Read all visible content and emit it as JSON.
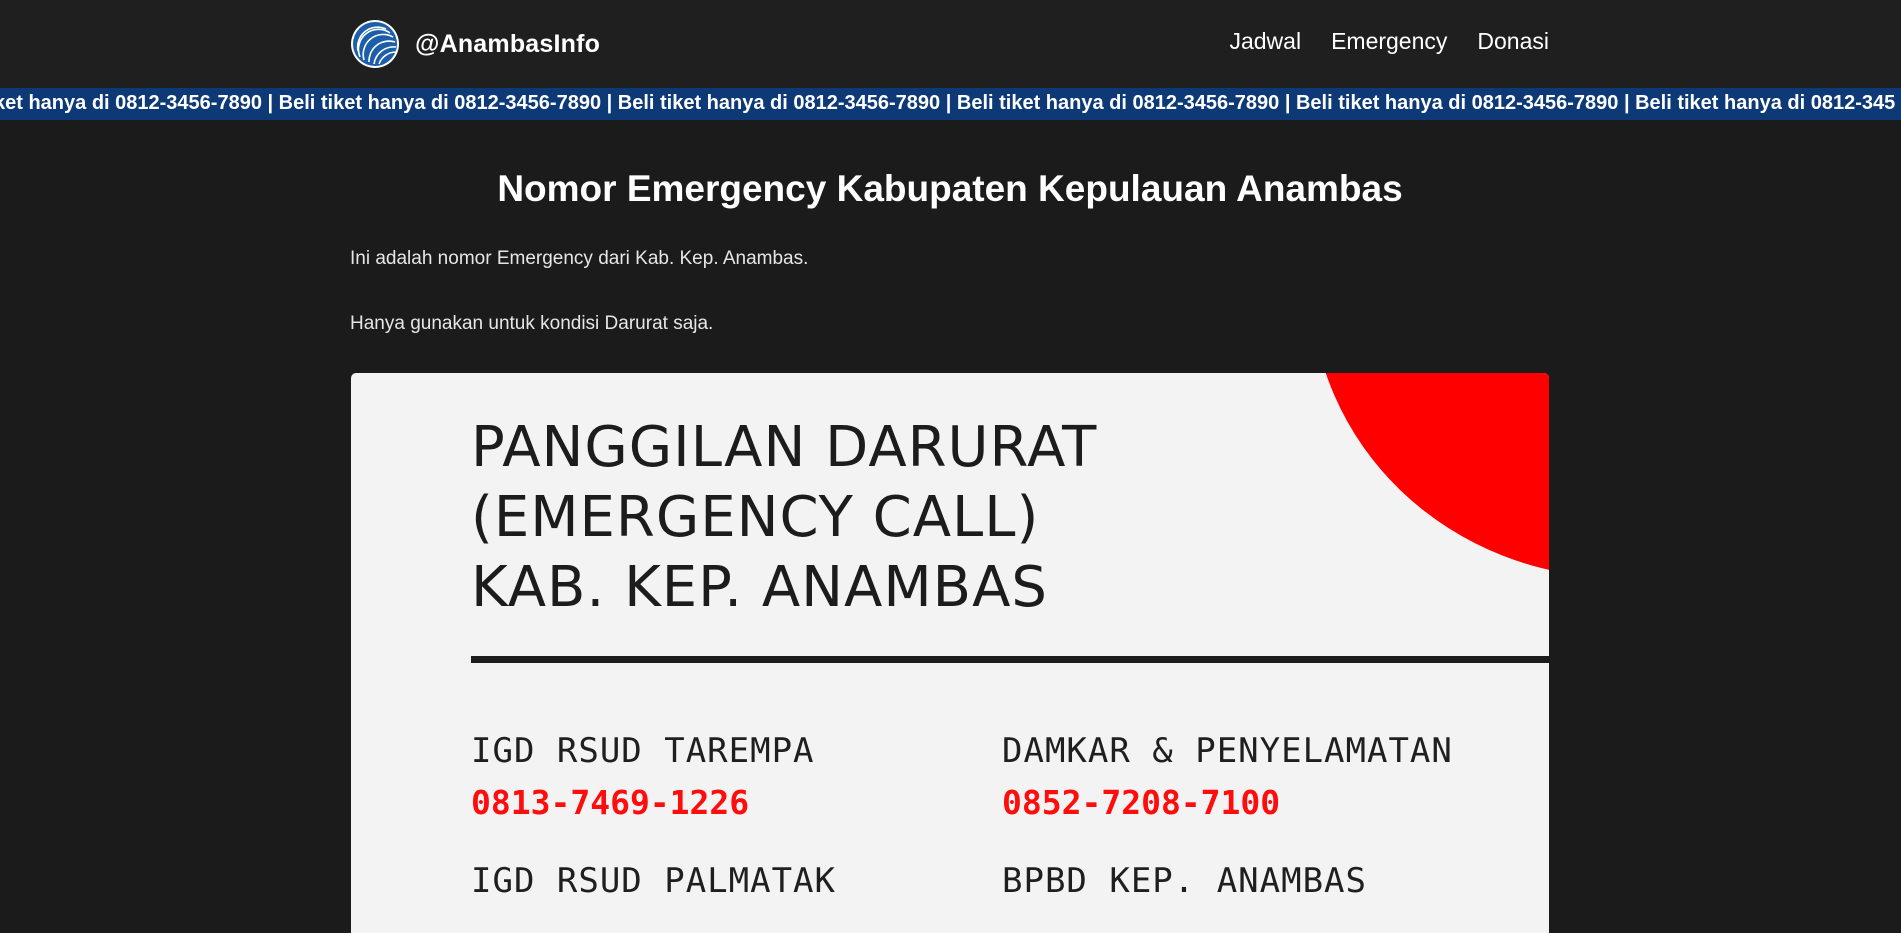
{
  "nav": {
    "brand": "@AnambasInfo",
    "links": [
      "Jadwal",
      "Emergency",
      "Donasi"
    ]
  },
  "ticker": {
    "text": "ket hanya di 0812-3456-7890 | Beli tiket hanya di 0812-3456-7890 | Beli tiket hanya di 0812-3456-7890 | Beli tiket hanya di 0812-3456-7890 | Beli tiket hanya di 0812-3456-7890 | Beli tiket hanya di 0812-345"
  },
  "main": {
    "title": "Nomor Emergency Kabupaten Kepulauan Anambas",
    "intro": "Ini adalah nomor Emergency dari Kab. Kep. Anambas.",
    "note": "Hanya gunakan untuk kondisi Darurat saja."
  },
  "poster": {
    "title_lines": [
      "PANGGILAN DARURAT",
      "(EMERGENCY CALL)",
      "KAB. KEP. ANAMBAS"
    ],
    "entries": [
      {
        "name": "IGD RSUD TAREMPA",
        "phone": "0813-7469-1226"
      },
      {
        "name": "DAMKAR & PENYELAMATAN",
        "phone": "0852-7208-7100"
      },
      {
        "name": "IGD RSUD PALMATAK",
        "phone": ""
      },
      {
        "name": "BPBD KEP. ANAMBAS",
        "phone": ""
      }
    ]
  },
  "colors": {
    "background": "#1b1b1b",
    "navbar": "#1f1f1f",
    "ticker": "#0d3a77",
    "accent_red": "#ff0000",
    "poster_bg": "#f3f3f3"
  }
}
